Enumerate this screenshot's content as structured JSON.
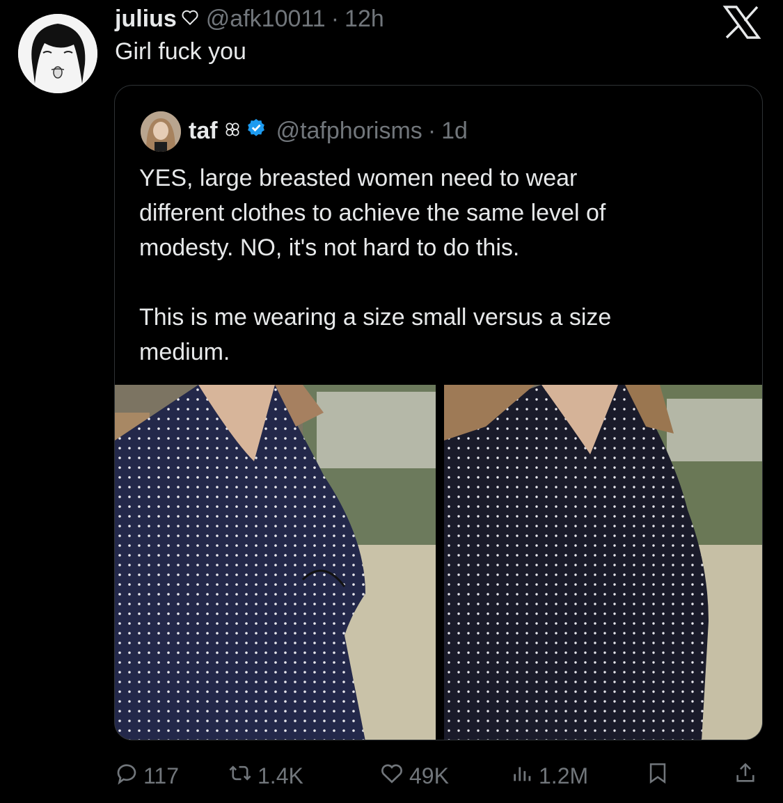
{
  "outer_tweet": {
    "name": "julius",
    "handle": "@afk10011",
    "separator": "·",
    "time": "12h",
    "text": "Girl fuck you"
  },
  "quoted_tweet": {
    "name": "taf",
    "handle": "@tafphorisms",
    "separator": "·",
    "time": "1d",
    "text": "YES, large breasted women need to wear\ndifferent clothes to achieve the same level of\nmodesty. NO, it's not hard to do this.\n\nThis is me wearing a size small versus a size\nmedium.",
    "verified_color": "#1d9bf0"
  },
  "actions": {
    "replies": "117",
    "reposts": "1.4K",
    "likes": "49K",
    "views": "1.2M"
  },
  "icons": [
    "heart-outline-icon",
    "x-logo-icon",
    "flower-icon",
    "verified-badge-icon",
    "reply-icon",
    "repost-icon",
    "like-icon",
    "views-icon",
    "bookmark-icon",
    "share-icon"
  ],
  "colors": {
    "background": "#000000",
    "text": "#e7e9ea",
    "muted": "#71767b",
    "border": "#2f3336"
  }
}
